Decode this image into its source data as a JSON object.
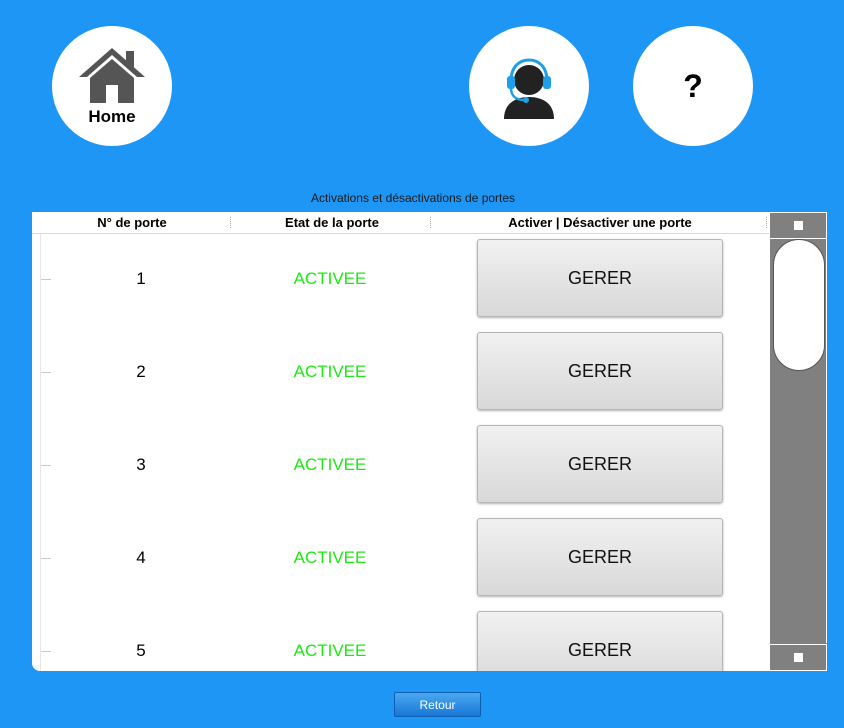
{
  "nav": {
    "home_label": "Home",
    "help_label": "?"
  },
  "table": {
    "caption": "Activations et désactivations de portes",
    "headers": [
      "N° de porte",
      "Etat de la porte",
      "Activer | Désactiver une porte"
    ],
    "rows": [
      {
        "num": "1",
        "status": "ACTIVEE",
        "action": "GERER"
      },
      {
        "num": "2",
        "status": "ACTIVEE",
        "action": "GERER"
      },
      {
        "num": "3",
        "status": "ACTIVEE",
        "action": "GERER"
      },
      {
        "num": "4",
        "status": "ACTIVEE",
        "action": "GERER"
      },
      {
        "num": "5",
        "status": "ACTIVEE",
        "action": "GERER"
      }
    ]
  },
  "footer": {
    "back_label": "Retour"
  },
  "colors": {
    "background": "#1e96f5",
    "status_active": "#1bea12",
    "scrollbar": "#808080",
    "headset_accent": "#1ea0e6"
  },
  "icons": {
    "home": "house-icon",
    "support": "headset-agent-icon",
    "help": "question-mark-icon"
  }
}
